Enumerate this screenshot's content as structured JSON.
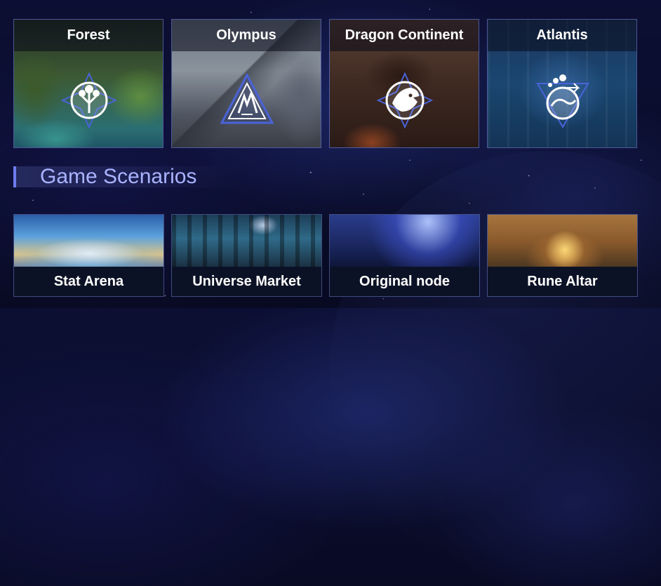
{
  "worlds": [
    {
      "name": "Forest",
      "emblem": "tree-emblem-icon"
    },
    {
      "name": "Olympus",
      "emblem": "mountain-emblem-icon"
    },
    {
      "name": "Dragon Continent",
      "emblem": "dragon-emblem-icon"
    },
    {
      "name": "Atlantis",
      "emblem": "wave-emblem-icon"
    }
  ],
  "section": {
    "title": "Game Scenarios"
  },
  "scenarios": [
    {
      "name": "Stat Arena"
    },
    {
      "name": "Universe Market"
    },
    {
      "name": "Original node"
    },
    {
      "name": "Rune Altar"
    }
  ],
  "colors": {
    "accent": "#6d7cf0",
    "section_title": "#a9b3ff",
    "card_border": "#8296e6",
    "emblem_stroke": "#4a63d8"
  }
}
